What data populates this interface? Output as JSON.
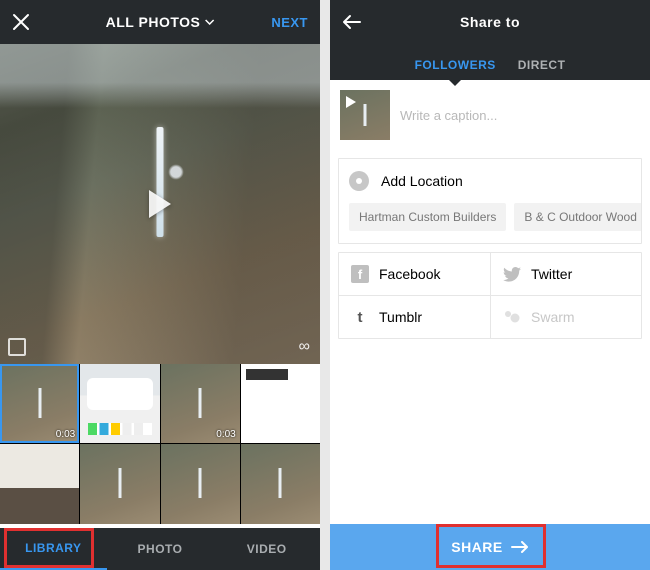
{
  "left": {
    "header": {
      "title": "ALL PHOTOS",
      "next": "NEXT"
    },
    "thumbs": [
      {
        "dur": "0:03"
      },
      {},
      {
        "dur": "0:03"
      },
      {},
      {},
      {},
      {},
      {}
    ],
    "tabs": {
      "library": "LIBRARY",
      "photo": "PHOTO",
      "video": "VIDEO"
    }
  },
  "right": {
    "header": {
      "title": "Share to"
    },
    "subtabs": {
      "followers": "FOLLOWERS",
      "direct": "DIRECT"
    },
    "caption_placeholder": "Write a caption...",
    "location_label": "Add Location",
    "chips": [
      "Hartman Custom Builders",
      "B & C Outdoor Wood Fu"
    ],
    "share": {
      "facebook": "Facebook",
      "twitter": "Twitter",
      "tumblr": "Tumblr",
      "swarm": "Swarm"
    },
    "share_button": "SHARE"
  }
}
